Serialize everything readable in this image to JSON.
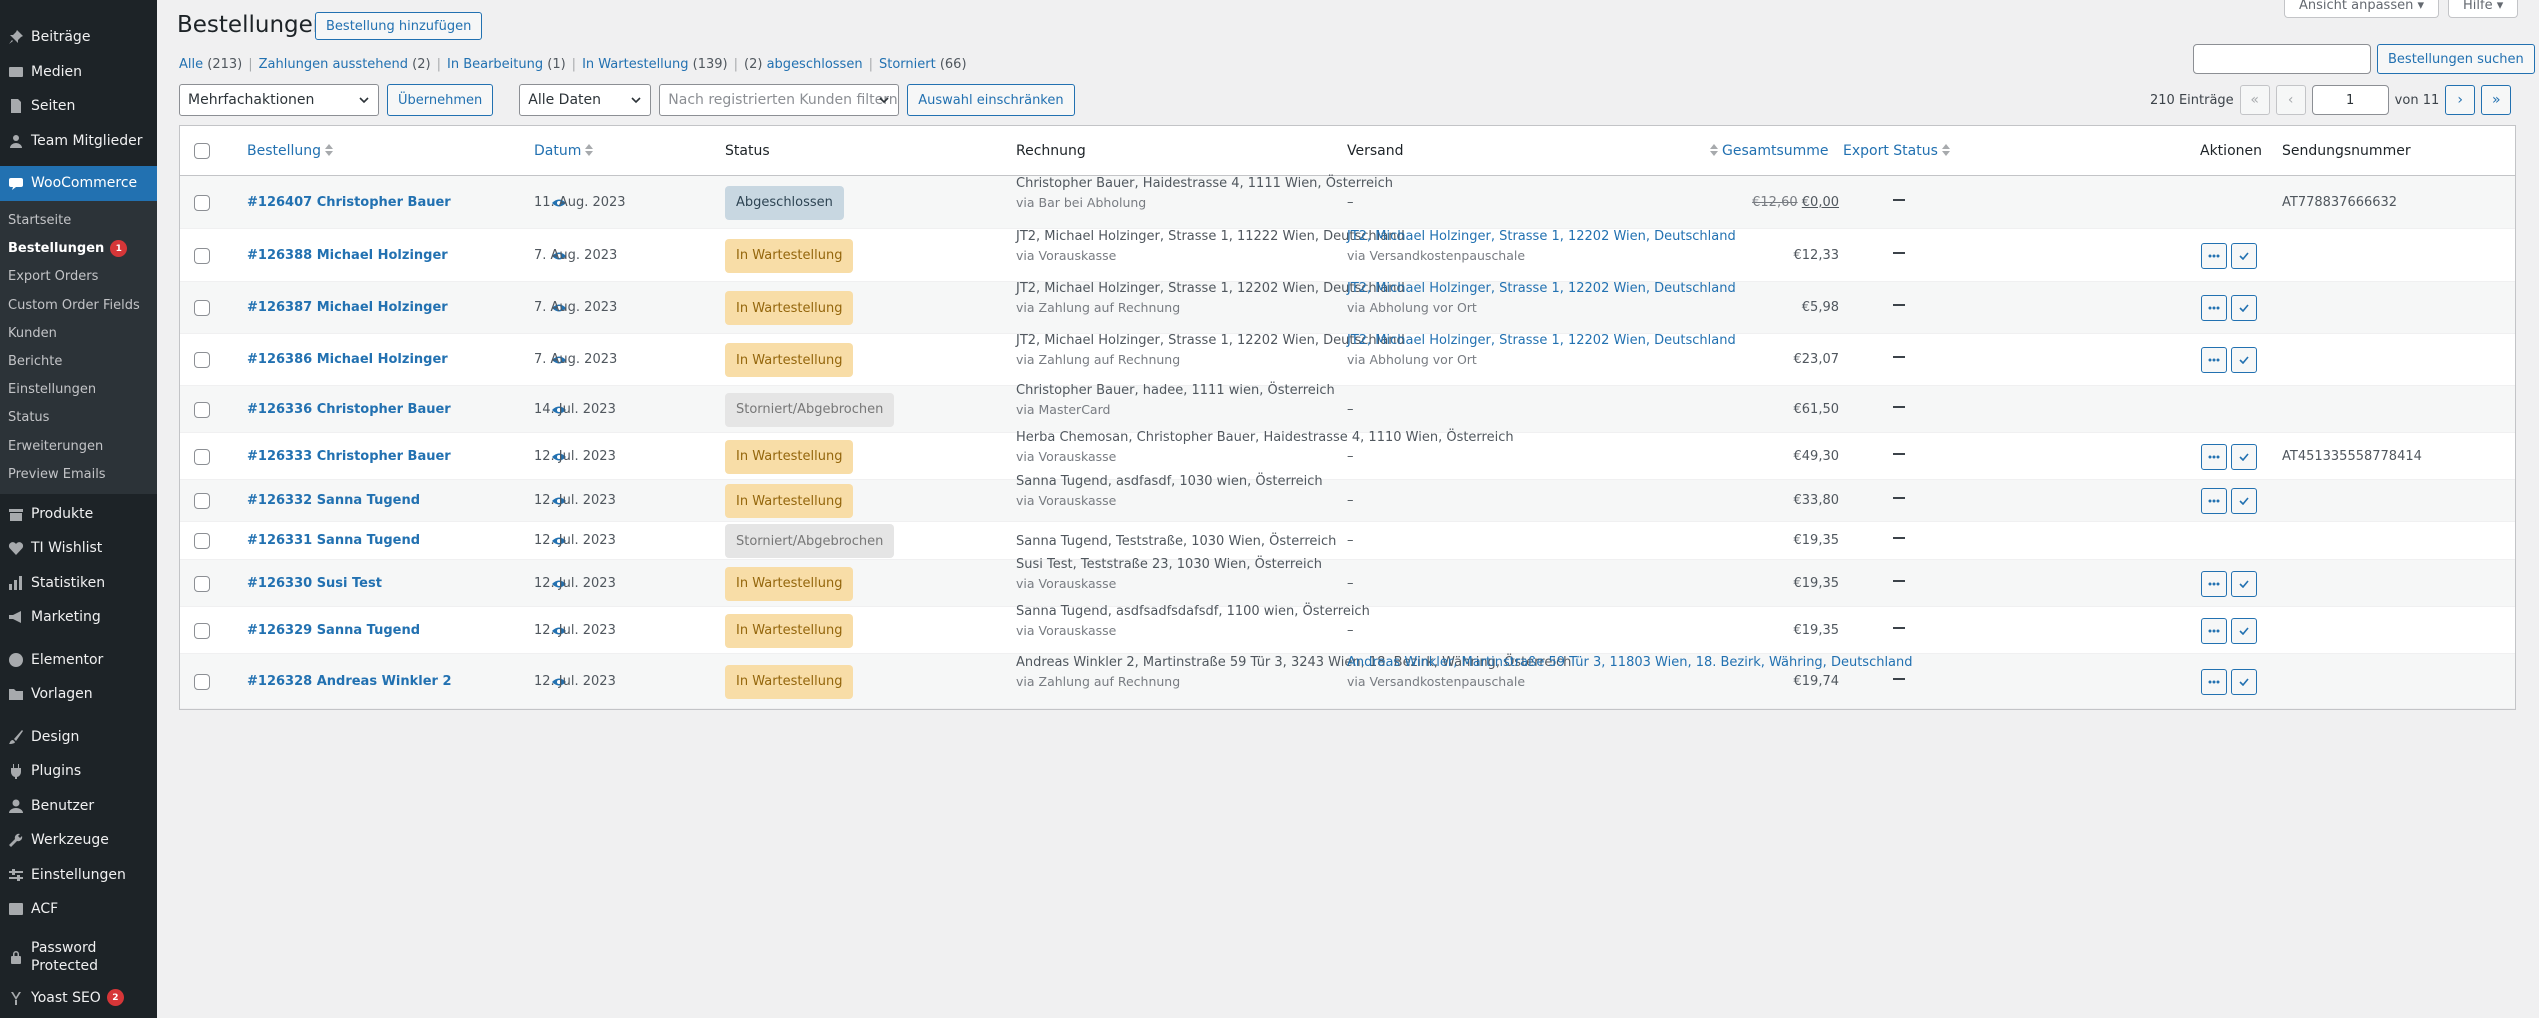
{
  "sidebar": {
    "top_items": [
      {
        "label": "Beiträge",
        "icon": "pin-icon"
      },
      {
        "label": "Medien",
        "icon": "media-icon"
      },
      {
        "label": "Seiten",
        "icon": "pages-icon"
      },
      {
        "label": "Team Mitglieder",
        "icon": "team-icon"
      }
    ],
    "woocommerce": {
      "label": "WooCommerce",
      "icon": "woocommerce-icon"
    },
    "submenu": [
      {
        "label": "Startseite"
      },
      {
        "label": "Bestellungen",
        "badge": "1"
      },
      {
        "label": "Export Orders"
      },
      {
        "label": "Custom Order Fields"
      },
      {
        "label": "Kunden"
      },
      {
        "label": "Berichte"
      },
      {
        "label": "Einstellungen"
      },
      {
        "label": "Status"
      },
      {
        "label": "Erweiterungen"
      },
      {
        "label": "Preview Emails"
      }
    ],
    "items2": [
      {
        "label": "Produkte",
        "icon": "products-icon"
      },
      {
        "label": "TI Wishlist",
        "icon": "heart-icon"
      },
      {
        "label": "Statistiken",
        "icon": "stats-icon"
      },
      {
        "label": "Marketing",
        "icon": "megaphone-icon"
      }
    ],
    "items3": [
      {
        "label": "Elementor",
        "icon": "elementor-icon"
      },
      {
        "label": "Vorlagen",
        "icon": "folder-icon"
      }
    ],
    "items4": [
      {
        "label": "Design",
        "icon": "brush-icon"
      },
      {
        "label": "Plugins",
        "icon": "plugin-icon"
      },
      {
        "label": "Benutzer",
        "icon": "user-icon"
      },
      {
        "label": "Werkzeuge",
        "icon": "wrench-icon"
      },
      {
        "label": "Einstellungen",
        "icon": "settings-icon"
      },
      {
        "label": "ACF",
        "icon": "acf-icon"
      }
    ],
    "password": {
      "line1": "Password",
      "line2": "Protected"
    },
    "yoast": {
      "label": "Yoast SEO",
      "badge": "2"
    }
  },
  "header": {
    "title": "Bestellungen",
    "add_button": "Bestellung hinzufügen",
    "screen_options": "Ansicht anpassen ▾",
    "help": "Hilfe ▾"
  },
  "filters": {
    "all": "Alle",
    "all_count": "(213)",
    "pending": "Zahlungen ausstehend",
    "pending_count": "(2)",
    "processing": "In Bearbeitung",
    "processing_count": "(1)",
    "onhold": "In Wartestellung",
    "onhold_count": "(139)",
    "completed_count": "(2)",
    "completed": "abgeschlossen",
    "cancelled": "Storniert",
    "cancelled_count": "(66)"
  },
  "search": {
    "button": "Bestellungen suchen",
    "value": ""
  },
  "tablenav": {
    "bulk_actions": "Mehrfachaktionen",
    "apply": "Übernehmen",
    "dates": "Alle Daten",
    "customer_placeholder": "Nach registrierten Kunden filtern",
    "filter": "Auswahl einschränken"
  },
  "pagination": {
    "items": "210 Einträge",
    "first": "«",
    "prev": "‹",
    "next": "›",
    "last": "»",
    "current": "1",
    "of": "von 11"
  },
  "columns": {
    "order": "Bestellung",
    "date": "Datum",
    "status": "Status",
    "billing": "Rechnung",
    "shipping": "Versand",
    "total": "Gesamtsumme",
    "export": "Export Status",
    "actions": "Aktionen",
    "tracking": "Sendungsnummer"
  },
  "orders": [
    {
      "order": "#126407 Christopher Bauer",
      "date": "11. Aug. 2023",
      "status": "Abgeschlossen",
      "status_type": "done",
      "billing": "Christopher Bauer, Haidestrasse 4, 1111 Wien, Österreich",
      "billing_via": "via Bar bei Abholung",
      "shipping": "",
      "shipping_via": "",
      "total_old": "€12,60",
      "total": "€0,00",
      "actions": false,
      "tracking": "AT778837666632"
    },
    {
      "order": "#126388 Michael Holzinger",
      "date": "7. Aug. 2023",
      "status": "In Wartestellung",
      "status_type": "hold",
      "billing": "JT2, Michael Holzinger, Strasse 1, 11222 Wien, Deutschland",
      "billing_via": "via Vorauskasse",
      "shipping": "JT2, Michael Holzinger, Strasse 1, 12202 Wien, Deutschland",
      "shipping_via": "via Versandkostenpauschale",
      "total_old": "",
      "total": "€12,33",
      "actions": true,
      "tracking": ""
    },
    {
      "order": "#126387 Michael Holzinger",
      "date": "7. Aug. 2023",
      "status": "In Wartestellung",
      "status_type": "hold",
      "billing": "JT2, Michael Holzinger, Strasse 1, 12202 Wien, Deutschland",
      "billing_via": "via Zahlung auf Rechnung",
      "shipping": "JT2, Michael Holzinger, Strasse 1, 12202 Wien, Deutschland",
      "shipping_via": "via Abholung vor Ort",
      "total_old": "",
      "total": "€5,98",
      "actions": true,
      "tracking": ""
    },
    {
      "order": "#126386 Michael Holzinger",
      "date": "7. Aug. 2023",
      "status": "In Wartestellung",
      "status_type": "hold",
      "billing": "JT2, Michael Holzinger, Strasse 1, 12202 Wien, Deutschland",
      "billing_via": "via Zahlung auf Rechnung",
      "shipping": "JT2, Michael Holzinger, Strasse 1, 12202 Wien, Deutschland",
      "shipping_via": "via Abholung vor Ort",
      "total_old": "",
      "total": "€23,07",
      "actions": true,
      "tracking": ""
    },
    {
      "order": "#126336 Christopher Bauer",
      "date": "14. Jul. 2023",
      "status": "Storniert/Abgebrochen",
      "status_type": "cancel",
      "billing": "Christopher Bauer, hadee, 1111 wien, Österreich",
      "billing_via": "via MasterCard",
      "shipping": "",
      "shipping_via": "",
      "total_old": "",
      "total": "€61,50",
      "actions": false,
      "tracking": ""
    },
    {
      "order": "#126333 Christopher Bauer",
      "date": "12. Jul. 2023",
      "status": "In Wartestellung",
      "status_type": "hold",
      "billing": "Herba Chemosan, Christopher Bauer, Haidestrasse 4, 1110 Wien, Österreich",
      "billing_via": "via Vorauskasse",
      "shipping": "",
      "shipping_via": "",
      "total_old": "",
      "total": "€49,30",
      "actions": true,
      "tracking": "AT451335558778414"
    },
    {
      "order": "#126332 Sanna Tugend",
      "date": "12. Jul. 2023",
      "status": "In Wartestellung",
      "status_type": "hold",
      "billing": "Sanna Tugend, asdfasdf, 1030 wien, Österreich",
      "billing_via": "via Vorauskasse",
      "shipping": "",
      "shipping_via": "",
      "total_old": "",
      "total": "€33,80",
      "actions": true,
      "tracking": ""
    },
    {
      "order": "#126331 Sanna Tugend",
      "date": "12. Jul. 2023",
      "status": "Storniert/Abgebrochen",
      "status_type": "cancel",
      "billing": "Sanna Tugend, Teststraße, 1030 Wien, Österreich",
      "billing_via": "",
      "shipping": "",
      "shipping_via": "",
      "total_old": "",
      "total": "€19,35",
      "actions": false,
      "tracking": ""
    },
    {
      "order": "#126330 Susi Test",
      "date": "12. Jul. 2023",
      "status": "In Wartestellung",
      "status_type": "hold",
      "billing": "Susi Test, Teststraße 23, 1030 Wien, Österreich",
      "billing_via": "via Vorauskasse",
      "shipping": "",
      "shipping_via": "",
      "total_old": "",
      "total": "€19,35",
      "actions": true,
      "tracking": ""
    },
    {
      "order": "#126329 Sanna Tugend",
      "date": "12. Jul. 2023",
      "status": "In Wartestellung",
      "status_type": "hold",
      "billing": "Sanna Tugend, asdfsadfsdafsdf, 1100 wien, Österreich",
      "billing_via": "via Vorauskasse",
      "shipping": "",
      "shipping_via": "",
      "total_old": "",
      "total": "€19,35",
      "actions": true,
      "tracking": ""
    },
    {
      "order": "#126328 Andreas Winkler 2",
      "date": "12. Jul. 2023",
      "status": "In Wartestellung",
      "status_type": "hold",
      "billing": "Andreas Winkler 2, Martinstraße 59 Tür 3, 3243 Wien, 18. Bezirk, Währing, Österreich",
      "billing_via": "via Zahlung auf Rechnung",
      "shipping": "Andreas Winkler, Martinstraße 59 Tür 3, 11803 Wien, 18. Bezirk, Währing, Deutschland",
      "shipping_via": "via Versandkostenpauschale",
      "total_old": "",
      "total": "€19,74",
      "actions": true,
      "tracking": ""
    }
  ],
  "empty_shipping": "–",
  "colors": {
    "accent": "#2271b1",
    "sidebar": "#1d2327",
    "badge": "#d63638"
  }
}
